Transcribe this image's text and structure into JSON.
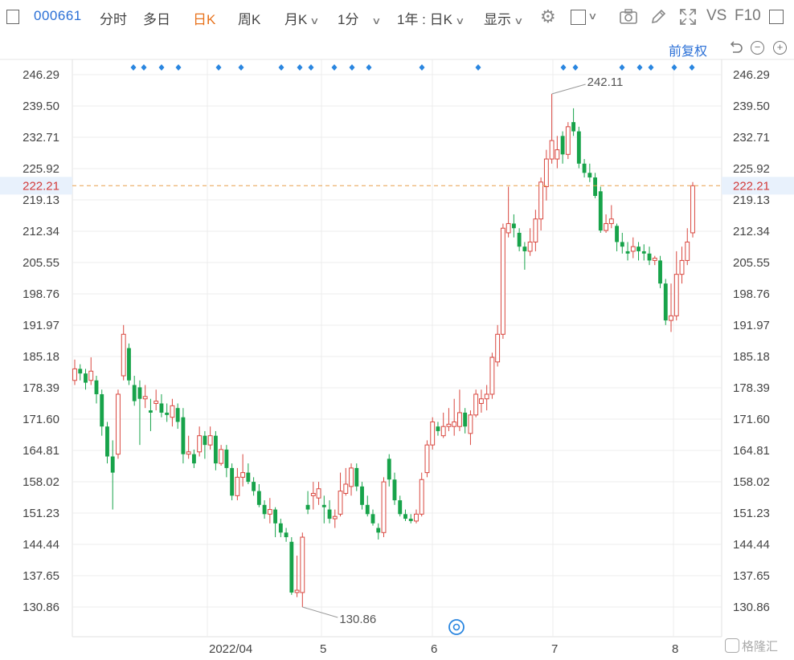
{
  "toolbar": {
    "stock_code": "000661",
    "tabs": [
      "分时",
      "多日",
      "日K",
      "周K",
      "月K",
      "1分"
    ],
    "active_tab": "日K",
    "range_label": "1年 : 日K",
    "display_label": "显示",
    "vs_label": "VS",
    "f10_label": "F10",
    "icons": [
      "gear-icon",
      "square-icon",
      "camera-icon",
      "pencil-icon",
      "expand-icon"
    ]
  },
  "chart_toolbar": {
    "adjust_label": "前复权",
    "icons": [
      "undo-icon",
      "zoom-out-icon",
      "zoom-in-icon"
    ]
  },
  "watermark": "格隆汇",
  "chart_data": {
    "type": "candlestick",
    "y_ticks": [
      "246.29",
      "239.50",
      "232.71",
      "225.92",
      "219.13",
      "212.34",
      "205.55",
      "198.76",
      "191.97",
      "185.18",
      "178.39",
      "171.60",
      "164.81",
      "158.02",
      "151.23",
      "144.44",
      "137.65",
      "130.86"
    ],
    "ylim": [
      130.86,
      246.29
    ],
    "x_labels": [
      "2022/04",
      "5",
      "6",
      "7",
      "8"
    ],
    "current_price": "222.21",
    "max_label": "242.11",
    "min_label": "130.86",
    "up_color": "#d9473f",
    "down_color": "#17a34a",
    "dash_color": "#e8a04a",
    "candles": [
      [
        180.0,
        182.5,
        184.5,
        179.0
      ],
      [
        182.5,
        181.5,
        183.5,
        180.0
      ],
      [
        181.5,
        179.5,
        182.5,
        178.0
      ],
      [
        180.0,
        182.0,
        185.0,
        179.0
      ],
      [
        180.0,
        177.0,
        181.0,
        175.0
      ],
      [
        177.0,
        170.0,
        178.0,
        168.0
      ],
      [
        170.0,
        163.5,
        171.0,
        162.0
      ],
      [
        163.5,
        160.0,
        167.0,
        152.0
      ],
      [
        164.0,
        177.0,
        178.0,
        163.0
      ],
      [
        181.0,
        190.0,
        192.0,
        180.0
      ],
      [
        187.0,
        180.0,
        188.0,
        179.0
      ],
      [
        179.0,
        175.5,
        181.0,
        174.5
      ],
      [
        178.5,
        176.0,
        180.0,
        166.0
      ],
      [
        176.0,
        176.5,
        179.0,
        174.0
      ],
      [
        173.5,
        173.0,
        176.0,
        169.0
      ],
      [
        175.0,
        175.5,
        178.0,
        173.5
      ],
      [
        175.0,
        173.0,
        177.0,
        172.0
      ],
      [
        173.0,
        172.5,
        175.0,
        171.0
      ],
      [
        172.0,
        174.5,
        176.0,
        170.0
      ],
      [
        174.0,
        171.0,
        175.0,
        169.5
      ],
      [
        172.0,
        164.0,
        174.0,
        162.0
      ],
      [
        164.0,
        164.5,
        168.0,
        163.0
      ],
      [
        164.0,
        162.0,
        165.0,
        161.0
      ],
      [
        164.5,
        168.0,
        170.0,
        163.5
      ],
      [
        168.0,
        166.0,
        169.0,
        163.0
      ],
      [
        166.0,
        168.0,
        170.0,
        165.0
      ],
      [
        168.0,
        162.0,
        169.0,
        160.5
      ],
      [
        162.0,
        165.0,
        166.0,
        161.5
      ],
      [
        165.0,
        161.0,
        166.0,
        159.0
      ],
      [
        161.0,
        155.0,
        162.0,
        154.0
      ],
      [
        155.0,
        159.0,
        161.0,
        154.0
      ],
      [
        159.0,
        160.0,
        164.0,
        157.0
      ],
      [
        160.0,
        158.0,
        162.0,
        157.5
      ],
      [
        158.0,
        156.0,
        159.0,
        155.0
      ],
      [
        156.0,
        153.0,
        157.5,
        152.5
      ],
      [
        153.0,
        151.0,
        154.0,
        150.0
      ],
      [
        151.0,
        152.0,
        154.5,
        149.0
      ],
      [
        152.0,
        149.0,
        152.5,
        146.0
      ],
      [
        149.0,
        147.0,
        150.0,
        146.0
      ],
      [
        147.0,
        146.0,
        148.0,
        145.0
      ],
      [
        145.0,
        134.0,
        146.0,
        133.5
      ],
      [
        134.0,
        134.5,
        142.0,
        133.0
      ],
      [
        134.0,
        146.0,
        147.0,
        130.86
      ],
      [
        153.0,
        152.0,
        156.0,
        151.0
      ],
      [
        155.0,
        155.5,
        158.0,
        152.0
      ],
      [
        154.5,
        156.5,
        158.0,
        153.0
      ],
      [
        153.0,
        152.5,
        155.0,
        149.0
      ],
      [
        152.0,
        150.0,
        154.0,
        149.0
      ],
      [
        150.0,
        150.5,
        152.0,
        148.0
      ],
      [
        151.0,
        156.0,
        160.0,
        150.5
      ],
      [
        155.5,
        157.5,
        161.0,
        155.0
      ],
      [
        157.0,
        161.0,
        162.0,
        155.0
      ],
      [
        161.0,
        157.0,
        162.0,
        156.0
      ],
      [
        157.0,
        153.0,
        158.0,
        152.0
      ],
      [
        153.0,
        151.0,
        155.0,
        150.5
      ],
      [
        151.0,
        149.0,
        152.0,
        148.5
      ],
      [
        148.0,
        147.0,
        149.0,
        145.5
      ],
      [
        147.0,
        158.0,
        159.0,
        146.0
      ],
      [
        163.0,
        158.5,
        164.0,
        157.0
      ],
      [
        158.5,
        154.0,
        160.0,
        153.0
      ],
      [
        154.0,
        151.0,
        155.0,
        150.5
      ],
      [
        151.0,
        150.0,
        152.0,
        149.5
      ],
      [
        150.0,
        149.5,
        151.0,
        149.0
      ],
      [
        149.5,
        151.0,
        152.0,
        149.0
      ],
      [
        151.0,
        158.5,
        160.0,
        150.5
      ],
      [
        160.0,
        166.0,
        167.0,
        159.0
      ],
      [
        166.0,
        171.0,
        172.0,
        165.0
      ],
      [
        170.0,
        169.0,
        171.0,
        168.0
      ],
      [
        168.0,
        170.0,
        173.0,
        167.5
      ],
      [
        170.0,
        170.5,
        174.0,
        169.0
      ],
      [
        170.0,
        171.0,
        176.0,
        168.0
      ],
      [
        170.0,
        173.0,
        178.0,
        169.0
      ],
      [
        173.0,
        170.0,
        174.0,
        168.5
      ],
      [
        168.5,
        172.5,
        173.5,
        166.0
      ],
      [
        172.5,
        177.0,
        178.0,
        172.0
      ],
      [
        175.0,
        176.0,
        178.0,
        173.0
      ],
      [
        176.0,
        177.0,
        179.0,
        173.5
      ],
      [
        177.0,
        185.0,
        186.0,
        176.0
      ],
      [
        184.0,
        190.0,
        192.0,
        183.0
      ],
      [
        190.0,
        213.0,
        214.0,
        189.0
      ],
      [
        212.0,
        214.0,
        222.0,
        211.0
      ],
      [
        214.0,
        213.0,
        216.0,
        211.0
      ],
      [
        212.0,
        209.0,
        213.0,
        208.0
      ],
      [
        209.0,
        208.0,
        210.0,
        204.0
      ],
      [
        208.0,
        210.0,
        213.0,
        207.0
      ],
      [
        210.0,
        215.0,
        217.0,
        208.0
      ],
      [
        215.0,
        223.0,
        224.0,
        212.5
      ],
      [
        222.0,
        228.0,
        230.0,
        219.0
      ],
      [
        228.0,
        232.0,
        242.11,
        227.0
      ],
      [
        228.0,
        230.0,
        233.0,
        226.0
      ],
      [
        233.0,
        229.0,
        234.0,
        227.0
      ],
      [
        229.0,
        235.0,
        236.0,
        228.0
      ],
      [
        236.0,
        234.0,
        239.0,
        233.0
      ],
      [
        234.0,
        227.0,
        235.0,
        226.0
      ],
      [
        227.0,
        225.0,
        228.0,
        224.0
      ],
      [
        225.0,
        224.0,
        227.0,
        223.0
      ],
      [
        224.0,
        220.0,
        225.0,
        219.5
      ],
      [
        221.0,
        212.5,
        222.0,
        212.0
      ],
      [
        212.5,
        214.0,
        216.0,
        212.0
      ],
      [
        214.0,
        215.0,
        218.0,
        213.0
      ],
      [
        213.5,
        210.0,
        214.0,
        208.0
      ],
      [
        210.0,
        209.0,
        212.0,
        207.5
      ],
      [
        208.0,
        207.5,
        210.0,
        206.0
      ],
      [
        208.0,
        209.0,
        211.0,
        206.5
      ],
      [
        209.0,
        208.0,
        210.0,
        206.0
      ],
      [
        208.0,
        207.5,
        209.5,
        206.0
      ],
      [
        207.5,
        206.0,
        209.0,
        205.0
      ],
      [
        206.0,
        206.5,
        207.0,
        205.0
      ],
      [
        206.0,
        201.0,
        207.0,
        200.0
      ],
      [
        201.0,
        193.0,
        202.0,
        192.0
      ],
      [
        193.0,
        194.0,
        201.0,
        190.5
      ],
      [
        194.0,
        203.0,
        208.0,
        193.0
      ],
      [
        203.0,
        206.0,
        209.0,
        201.0
      ],
      [
        206.0,
        210.0,
        213.0,
        205.0
      ],
      [
        212.0,
        222.21,
        223.0,
        211.0
      ]
    ],
    "markers": [
      166,
      179,
      201,
      222,
      272,
      300,
      350,
      373,
      387,
      416,
      438,
      459,
      525,
      595,
      701,
      716,
      774,
      796,
      810,
      839,
      861
    ]
  }
}
